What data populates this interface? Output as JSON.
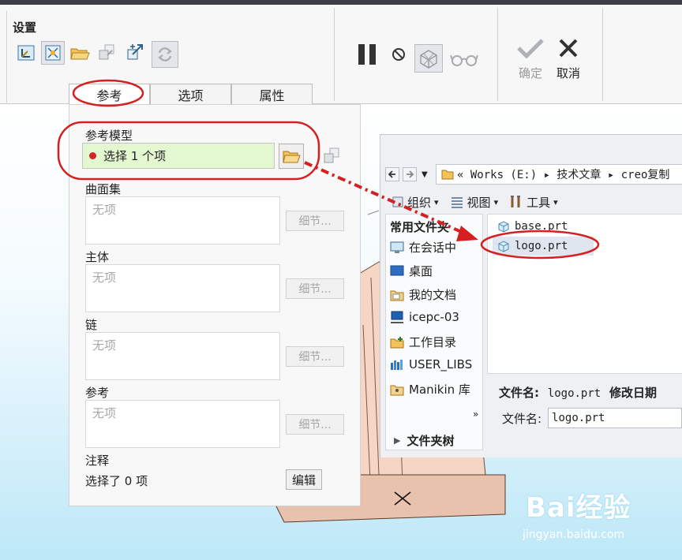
{
  "ribbon": {
    "group_title": "设置",
    "tools": [
      {
        "icon": "csys-icon"
      },
      {
        "icon": "datum-point-icon"
      },
      {
        "icon": "open-folder-icon"
      },
      {
        "icon": "copy-geometry-icon"
      },
      {
        "icon": "transform-icon"
      },
      {
        "icon": "refresh-icon"
      }
    ],
    "controls": [
      {
        "icon": "pause-icon"
      },
      {
        "icon": "no-symbol-icon"
      },
      {
        "icon": "preview-geometry-icon"
      },
      {
        "icon": "glasses-icon"
      }
    ],
    "confirm_label": "确定",
    "cancel_label": "取消"
  },
  "tabs": [
    "参考",
    "选项",
    "属性"
  ],
  "panel": {
    "ref_model_label": "参考模型",
    "ref_model_value": "选择 1 个项",
    "sections": [
      {
        "label": "曲面集",
        "value": "无项",
        "button": "细节..."
      },
      {
        "label": "主体",
        "value": "无项",
        "button": "细节..."
      },
      {
        "label": "链",
        "value": "无项",
        "button": "细节..."
      },
      {
        "label": "参考",
        "value": "无项",
        "button": "细节..."
      }
    ],
    "note_label": "注释",
    "note_text": "选择了 0 项",
    "edit_button": "编辑"
  },
  "dialog": {
    "path": "« Works (E:) ▸ 技术文章 ▸ creo复制",
    "toolbar": {
      "organize": "组织",
      "view": "视图",
      "tools": "工具"
    },
    "sidebar_header": "常用文件夹",
    "sidebar_items": [
      {
        "label": "在会话中",
        "icon": "session-icon"
      },
      {
        "label": "桌面",
        "icon": "desktop-icon"
      },
      {
        "label": "我的文档",
        "icon": "documents-icon"
      },
      {
        "label": "icepc-03",
        "icon": "computer-icon"
      },
      {
        "label": "工作目录",
        "icon": "work-folder-icon"
      },
      {
        "label": "USER_LIBS",
        "icon": "library-icon"
      },
      {
        "label": "Manikin 库",
        "icon": "manikin-icon"
      }
    ],
    "folder_tree_label": "文件夹树",
    "files": [
      {
        "name": "base.prt",
        "selected": false
      },
      {
        "name": "logo.prt",
        "selected": true
      }
    ],
    "info_label": "文件名:",
    "info_value": "logo.prt",
    "info_modified": "修改日期",
    "filename_label": "文件名:",
    "filename_value": "logo.prt"
  },
  "watermark": {
    "main": "Bai经验",
    "sub": "jingyan.baidu.com"
  }
}
